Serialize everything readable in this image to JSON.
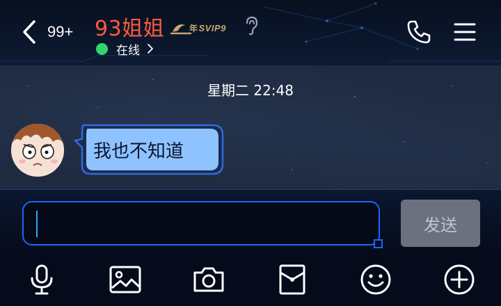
{
  "header": {
    "unread_count": "99+",
    "contact_name": "93姐姐",
    "vip_badge": {
      "prefix": "年",
      "label": "SVIP9"
    },
    "status": "在线",
    "status_color": "#32d66a",
    "name_color": "#ff5a3c",
    "icons": [
      "back-arrow-icon",
      "hearing-icon",
      "phone-icon",
      "menu-icon"
    ]
  },
  "chat": {
    "messages": [
      {
        "timestamp": "星期二 22:48",
        "sender": "contact",
        "text": "我也不知道"
      }
    ],
    "bubble_color": "#8fc3ff"
  },
  "input": {
    "value": "",
    "send_label": "发送"
  },
  "toolbar": {
    "items": [
      "microphone-icon",
      "image-icon",
      "camera-icon",
      "red-packet-icon",
      "emoji-icon",
      "plus-icon"
    ]
  }
}
